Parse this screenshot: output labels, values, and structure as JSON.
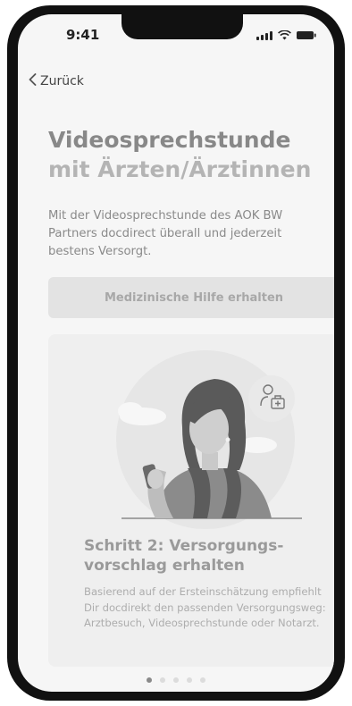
{
  "status_bar": {
    "time": "9:41"
  },
  "nav": {
    "back_label": "Zurück"
  },
  "header": {
    "title_line1": "Videosprechstunde",
    "title_line2": "mit Ärzten/Ärztinnen"
  },
  "intro": {
    "text": "Mit der Videosprechstunde des AOK BW Partners docdirect überall und jederzeit bestens Versorgt."
  },
  "cta": {
    "label": "Medizinische Hilfe erhalten"
  },
  "card": {
    "step_title": "Schritt 2: Versorgungs-vorschlag erhalten",
    "step_description": "Basierend auf der Ersteinschätzung empfiehlt Dir docdirekt den passenden Versorgungsweg: Arztbesuch, Videosprechstunde oder Notarzt."
  },
  "pager": {
    "total": 5,
    "active": 1
  },
  "colors": {
    "accent_muted": "#888888",
    "button_bg": "#e3e3e3"
  }
}
